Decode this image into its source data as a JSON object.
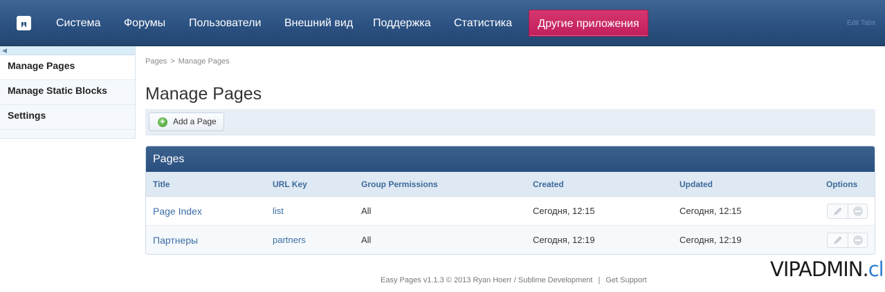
{
  "nav": {
    "tabs": [
      {
        "label": "Система"
      },
      {
        "label": "Форумы"
      },
      {
        "label": "Пользователи"
      },
      {
        "label": "Внешний вид"
      },
      {
        "label": "Поддержка"
      },
      {
        "label": "Статистика"
      }
    ],
    "special_tab": "Другие приложения",
    "edit_tabs": "Edit Tabs"
  },
  "sidebar": {
    "items": [
      {
        "label": "Manage Pages"
      },
      {
        "label": "Manage Static Blocks"
      },
      {
        "label": "Settings"
      }
    ]
  },
  "breadcrumb": {
    "root": "Pages",
    "separator": ">",
    "current": "Manage Pages"
  },
  "page_title": "Manage Pages",
  "toolbar": {
    "add_label": "Add a Page"
  },
  "pages_block": {
    "title": "Pages",
    "columns": [
      "Title",
      "URL Key",
      "Group Permissions",
      "Created",
      "Updated",
      "Options"
    ],
    "rows": [
      {
        "title": "Page Index",
        "url_key": "list",
        "permissions": "All",
        "created": "Сегодня, 12:15",
        "updated": "Сегодня, 12:15"
      },
      {
        "title": "Партнеры",
        "url_key": "partners",
        "permissions": "All",
        "created": "Сегодня, 12:19",
        "updated": "Сегодня, 12:19"
      }
    ]
  },
  "footer": {
    "credit": "Easy Pages v1.1.3 © 2013 Ryan Hoerr / Sublime Development",
    "separator": "|",
    "support": "Get Support"
  },
  "watermark": {
    "main": "VIPADMIN",
    "dot": ".",
    "club": "club"
  },
  "colors": {
    "nav_bg": "#2c5283",
    "special_tab": "#c8265f",
    "link": "#3b6ea5",
    "header_text": "#3d6a9b"
  }
}
